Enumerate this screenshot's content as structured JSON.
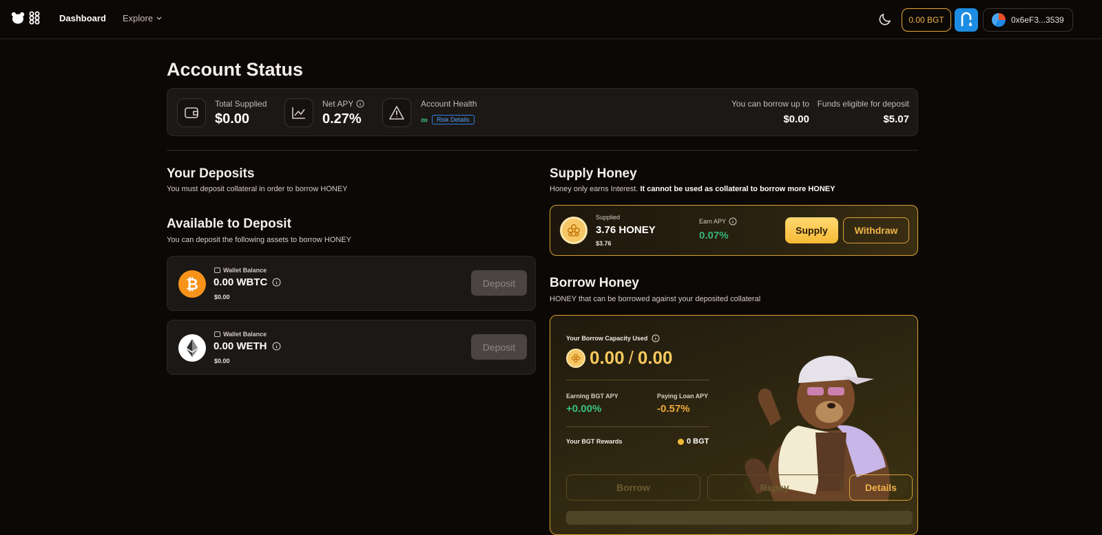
{
  "nav": {
    "dashboard": "Dashboard",
    "explore": "Explore",
    "bgt_balance": "0.00 BGT",
    "wallet_address": "0x6eF3...3539"
  },
  "account": {
    "title": "Account Status",
    "total_supplied_label": "Total Supplied",
    "total_supplied_value": "$0.00",
    "net_apy_label": "Net APY",
    "net_apy_value": "0.27%",
    "health_label": "Account Health",
    "health_value": "∞",
    "risk_details": "Risk Details",
    "borrow_up_to_label": "You can borrow up to",
    "borrow_up_to_value": "$0.00",
    "funds_eligible_label": "Funds eligible for deposit",
    "funds_eligible_value": "$5.07"
  },
  "deposits": {
    "title": "Your Deposits",
    "subtitle": "You must deposit collateral in order to borrow HONEY"
  },
  "available": {
    "title": "Available to Deposit",
    "subtitle": "You can deposit the following assets to borrow HONEY",
    "assets": [
      {
        "wallet_label": "Wallet Balance",
        "amount": "0.00 WBTC",
        "usd": "$0.00",
        "button": "Deposit"
      },
      {
        "wallet_label": "Wallet Balance",
        "amount": "0.00 WETH",
        "usd": "$0.00",
        "button": "Deposit"
      }
    ]
  },
  "supply_honey": {
    "title": "Supply Honey",
    "subtitle_plain": "Honey only earns Interest. ",
    "subtitle_bold": "It cannot be used as collateral to borrow more HONEY",
    "supplied_label": "Supplied",
    "supplied_amount": "3.76 HONEY",
    "supplied_usd": "$3.76",
    "earn_apy_label": "Earn APY",
    "earn_apy_value": "0.07%",
    "supply_button": "Supply",
    "withdraw_button": "Withdraw"
  },
  "borrow_honey": {
    "title": "Borrow Honey",
    "subtitle": "HONEY that can be borrowed against your deposited collateral",
    "capacity_label": "Your Borrow Capacity Used",
    "used": "0.00",
    "slash": "/",
    "capacity": "0.00",
    "earning_label": "Earning BGT APY",
    "earning_value": "+0.00%",
    "paying_label": "Paying Loan APY",
    "paying_value": "-0.57%",
    "rewards_label": "Your BGT Rewards",
    "rewards_value": "0 BGT",
    "borrow_button": "Borrow",
    "repay_button": "Repay",
    "details_button": "Details"
  },
  "colors": {
    "background": "#0c0806",
    "accent_gold": "#d9a235",
    "positive_green": "#35b47a",
    "negative_orange": "#f0a93b",
    "link_blue": "#2f7fe6"
  }
}
